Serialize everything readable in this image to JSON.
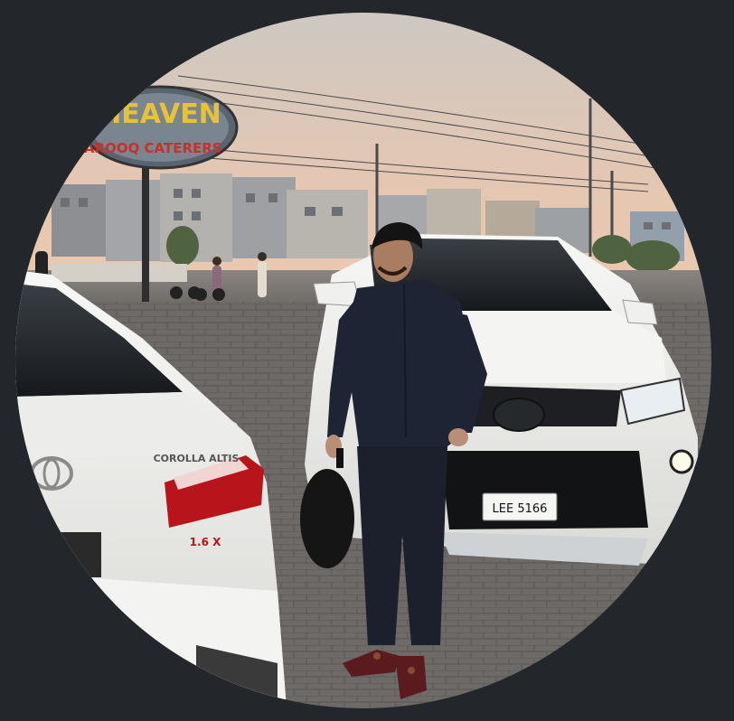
{
  "photo": {
    "sign": {
      "top_line": "HEAVEN",
      "bottom_line": "FAROOQ CATERERS"
    },
    "car_left": {
      "model_badge": "COROLLA ALTIS",
      "trim_badge": "1.6 X"
    },
    "car_right": {
      "plate": "LEE 5166"
    },
    "colors": {
      "background": "#23272b",
      "sky_top": "#cfc9c1",
      "sky_bottom": "#e6c5ae",
      "pavement": "#6f6c69",
      "suit": "#1e2231",
      "car_white": "#f2f2f0"
    }
  }
}
